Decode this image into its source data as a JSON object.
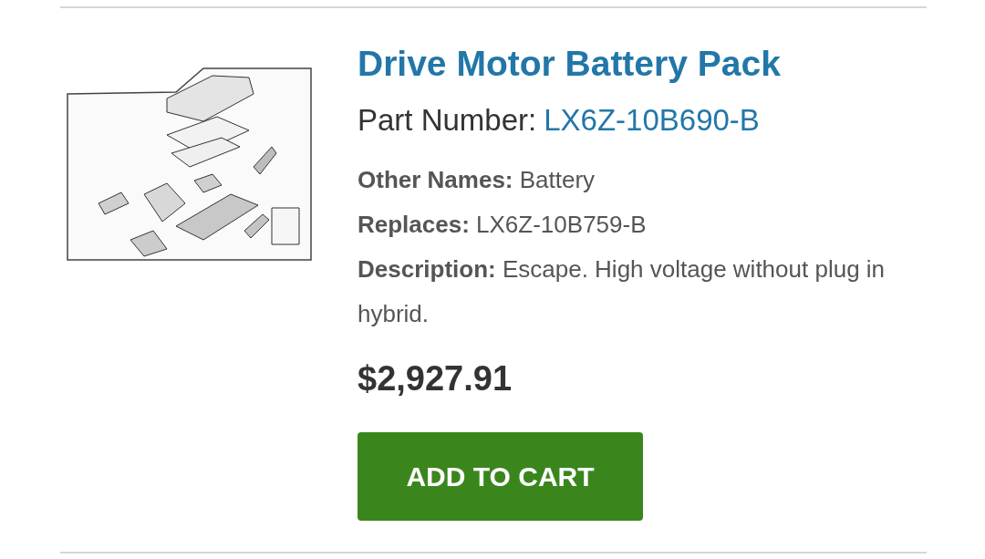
{
  "product": {
    "title": "Drive Motor Battery Pack",
    "part_number": {
      "label": "Part Number:",
      "value": "LX6Z-10B690-B"
    },
    "details": [
      {
        "label": "Other Names:",
        "value": "Battery"
      },
      {
        "label": "Replaces:",
        "value": "LX6Z-10B759-B"
      },
      {
        "label": "Description:",
        "value": "Escape. High voltage without plug in hybrid."
      }
    ],
    "price": "$2,927.91",
    "button": "ADD TO CART"
  }
}
